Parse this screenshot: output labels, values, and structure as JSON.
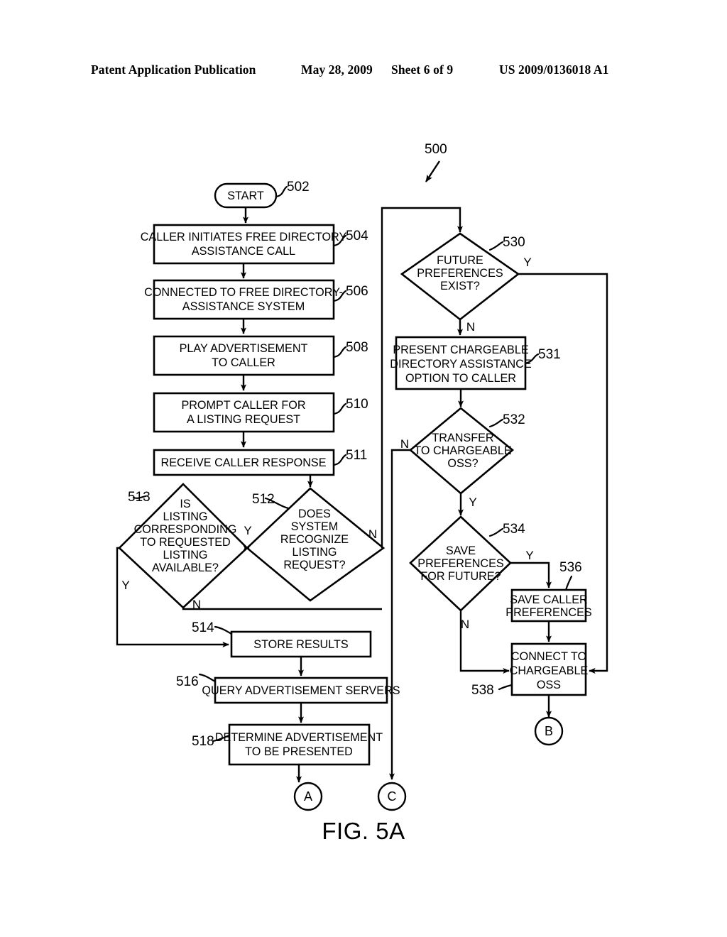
{
  "header": {
    "publication": "Patent Application Publication",
    "date": "May 28, 2009",
    "sheet": "Sheet 6 of 9",
    "number": "US 2009/0136018 A1"
  },
  "figure": {
    "caption": "FIG. 5A",
    "diagram_ref": "500"
  },
  "nodes": {
    "start": {
      "ref": "502",
      "label": "START"
    },
    "n504": {
      "ref": "504",
      "line1": "CALLER INITIATES FREE DIRECTORY",
      "line2": "ASSISTANCE CALL"
    },
    "n506": {
      "ref": "506",
      "line1": "CONNECTED TO FREE DIRECTORY-",
      "line2": "ASSISTANCE SYSTEM"
    },
    "n508": {
      "ref": "508",
      "line1": "PLAY ADVERTISEMENT",
      "line2": "TO CALLER"
    },
    "n510": {
      "ref": "510",
      "line1": "PROMPT CALLER FOR",
      "line2": "A LISTING REQUEST"
    },
    "n511": {
      "ref": "511",
      "line1": "RECEIVE CALLER RESPONSE"
    },
    "n512": {
      "ref": "512",
      "line1": "DOES",
      "line2": "SYSTEM",
      "line3": "RECOGNIZE",
      "line4": "LISTING",
      "line5": "REQUEST?",
      "yes": "Y",
      "no": "N"
    },
    "n513": {
      "ref": "513",
      "line1": "IS",
      "line2": "LISTING",
      "line3": "CORRESPONDING",
      "line4": "TO REQUESTED",
      "line5": "LISTING",
      "line6": "AVAILABLE?",
      "yes": "Y",
      "no": "N"
    },
    "n514": {
      "ref": "514",
      "line1": "STORE RESULTS"
    },
    "n516": {
      "ref": "516",
      "line1": "QUERY ADVERTISEMENT SERVERS"
    },
    "n518": {
      "ref": "518",
      "line1": "DETERMINE ADVERTISEMENT",
      "line2": "TO BE PRESENTED"
    },
    "n530": {
      "ref": "530",
      "line1": "FUTURE",
      "line2": "PREFERENCES",
      "line3": "EXIST?",
      "yes": "Y",
      "no": "N"
    },
    "n531": {
      "ref": "531",
      "line1": "PRESENT CHARGEABLE",
      "line2": "DIRECTORY ASSISTANCE",
      "line3": "OPTION TO CALLER"
    },
    "n532": {
      "ref": "532",
      "line1": "TRANSFER",
      "line2": "TO CHARGEABLE",
      "line3": "OSS?",
      "yes": "Y",
      "no": "N"
    },
    "n534": {
      "ref": "534",
      "line1": "SAVE",
      "line2": "PREFERENCES",
      "line3": "FOR FUTURE?",
      "yes": "Y",
      "no": "N"
    },
    "n536": {
      "ref": "536",
      "line1": "SAVE CALLER",
      "line2": "PREFERENCES"
    },
    "n538": {
      "ref": "538",
      "line1": "CONNECT TO",
      "line2": "CHARGEABLE",
      "line3": "OSS"
    },
    "connA": {
      "label": "A"
    },
    "connB": {
      "label": "B"
    },
    "connC": {
      "label": "C"
    }
  },
  "colors": {
    "ink": "#000000",
    "paper": "#ffffff"
  }
}
